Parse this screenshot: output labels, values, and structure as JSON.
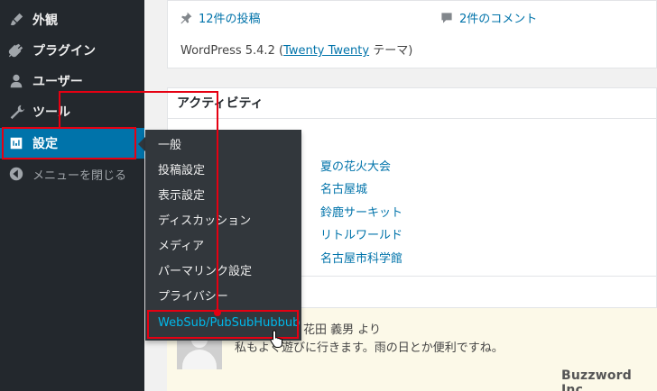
{
  "sidebar": {
    "items": [
      {
        "label": "外観",
        "icon": "brush-icon"
      },
      {
        "label": "プラグイン",
        "icon": "plugin-icon"
      },
      {
        "label": "ユーザー",
        "icon": "user-icon"
      },
      {
        "label": "ツール",
        "icon": "wrench-icon"
      },
      {
        "label": "設定",
        "icon": "settings-icon"
      },
      {
        "label": "メニューを閉じる",
        "icon": "collapse-icon"
      }
    ]
  },
  "flyout": {
    "items": [
      "一般",
      "投稿設定",
      "表示設定",
      "ディスカッション",
      "メディア",
      "パーマリンク設定",
      "プライバシー",
      "WebSub/PubSubHubbub"
    ]
  },
  "glance": {
    "posts": "12件の投稿",
    "comments": "2件のコメント",
    "version_prefix": "WordPress 5.4.2 (",
    "theme": "Twenty Twenty",
    "version_suffix": " テーマ)"
  },
  "activity": {
    "title": "アクティビティ",
    "posts": [
      "夏の花火大会",
      "名古屋城",
      "鈴鹿サーキット",
      "リトルワールド",
      "名古屋市科学館"
    ],
    "comment_author": "花田 義男 より",
    "comment_text": "私もよく遊びに行きます。雨の日とか便利ですね。"
  },
  "watermark": "Buzzword Inc.",
  "colors": {
    "accent": "#0073aa",
    "sidebar": "#23282d",
    "annotation": "#e60012"
  }
}
